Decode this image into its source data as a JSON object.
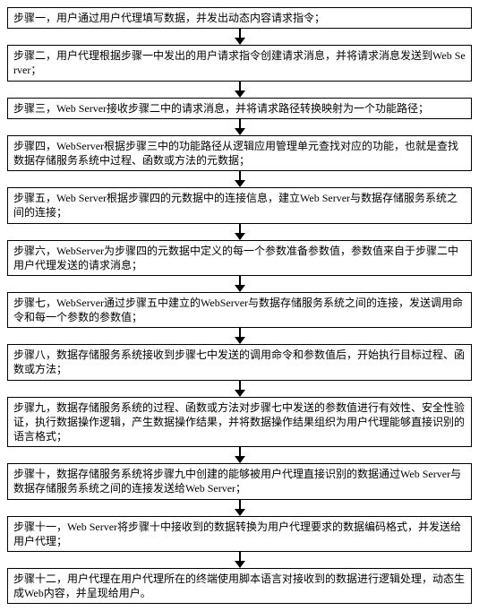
{
  "steps": [
    {
      "text": "步骤一，用户通过用户代理填写数据，并发出动态内容请求指令；"
    },
    {
      "text": "步骤二，用户代理根据步骤一中发出的用户请求指令创建请求消息，并将请求消息发送到Web Server；"
    },
    {
      "text": "步骤三，Web Server接收步骤二中的请求消息，并将请求路径转换映射为一个功能路径；"
    },
    {
      "text": "步骤四，WebServer根据步骤三中的功能路径从逻辑应用管理单元查找对应的功能，也就是查找数据存储服务系统中过程、函数或方法的元数据；"
    },
    {
      "text": "步骤五，Web Server根据步骤四的元数据中的连接信息，建立Web Server与数据存储服务系统之间的连接；"
    },
    {
      "text": "步骤六，WebServer为步骤四的元数据中定义的每一个参数准备参数值，参数值来自于步骤二中用户代理发送的请求消息；"
    },
    {
      "text": "步骤七，WebServer通过步骤五中建立的WebServer与数据存储服务系统之间的连接，发送调用命令和每一个参数的参数值；"
    },
    {
      "text": "步骤八，数据存储服务系统接收到步骤七中发送的调用命令和参数值后，开始执行目标过程、函数或方法；"
    },
    {
      "text": "步骤九，数据存储服务系统的过程、函数或方法对步骤七中发送的参数值进行有效性、安全性验证，执行数据操作逻辑，产生数据操作结果，并将数据操作结果组织为用户代理能够直接识别的语言格式；"
    },
    {
      "text": "步骤十，数据存储服务系统将步骤九中创建的能够被用户代理直接识别的数据通过Web Server与数据存储服务系统之间的连接发送给Web Server；"
    },
    {
      "text": "步骤十一，Web Server将步骤十中接收到的数据转换为用户代理要求的数据编码格式，并发送给用户代理；"
    },
    {
      "text": "步骤十二，用户代理在用户代理所在的终端使用脚本语言对接收到的数据进行逻辑处理，动态生成Web内容，并呈现给用户。"
    }
  ]
}
